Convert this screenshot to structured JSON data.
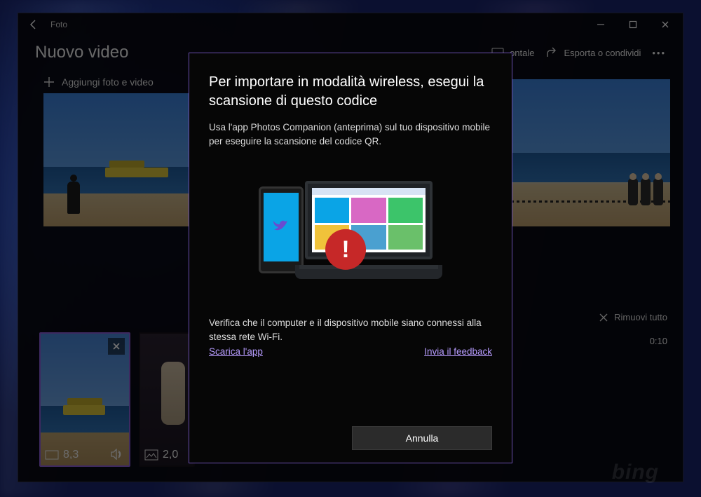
{
  "app": {
    "name": "Foto"
  },
  "header": {
    "title": "Nuovo video",
    "horizontal_partial": "ontale",
    "export": "Esporta o condividi"
  },
  "library": {
    "add_label": "Aggiungi foto e video"
  },
  "preview": {
    "duration": "0:10"
  },
  "storyboard": {
    "remove_all": "Rimuovi tutto",
    "clips": [
      {
        "duration": "8,3"
      },
      {
        "duration": "2,0"
      }
    ]
  },
  "dialog": {
    "title": "Per importare in modalità wireless, esegui la scansione di questo codice",
    "subtitle": "Usa l'app Photos Companion (anteprima) sul tuo dispositivo mobile per eseguire la scansione del codice QR.",
    "warning": "Verifica che il computer e il dispositivo mobile siano connessi alla stessa rete Wi-Fi.",
    "link_download": "Scarica l'app",
    "link_feedback": "Invia il feedback",
    "cancel": "Annulla",
    "error_glyph": "!"
  },
  "watermark": "bing"
}
